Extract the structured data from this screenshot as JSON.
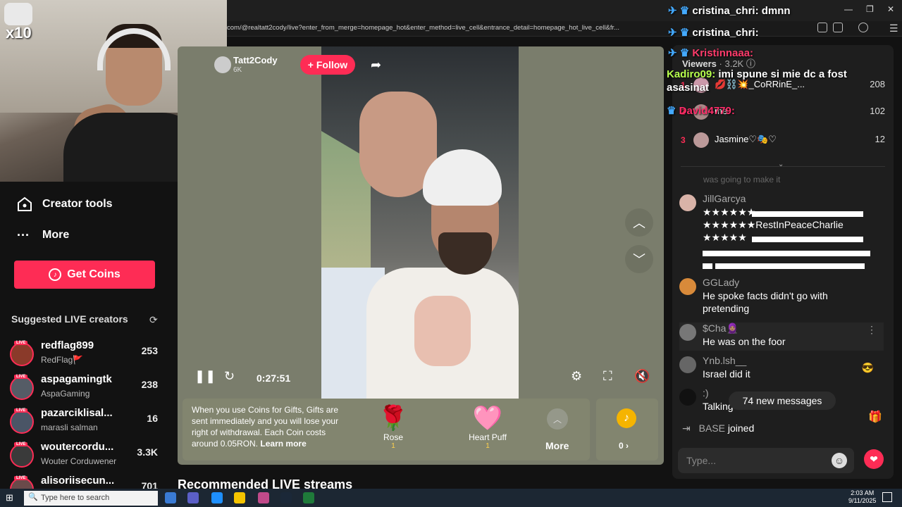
{
  "browser": {
    "url": "com/@realtatt2cody/live?enter_from_merge=homepage_hot&enter_method=live_cell&entrance_detail=homepage_hot_live_cell&fr...",
    "window_controls": [
      "—",
      "❐",
      "✕"
    ]
  },
  "stream_overlay": {
    "multiplier": "x10",
    "chat": [
      {
        "user": "cristina_chri:",
        "text": "dmnn",
        "color": "#ffffff"
      },
      {
        "user": "cristina_chri:",
        "text": "",
        "color": "#ffffff"
      },
      {
        "user": "Kristinnaaa:",
        "text": "",
        "color": "#ff3b6b"
      },
      {
        "user": "Kadiro09:",
        "text": "imi spune si mie dc a fost asasinat",
        "color": "#b7ff4d"
      },
      {
        "user": "David4779:",
        "text": "",
        "color": "#ff2d6a"
      }
    ]
  },
  "sidebar": {
    "items": [
      {
        "label": "Creator tools",
        "icon": "creator-tools-icon"
      },
      {
        "label": "More",
        "icon": "more-dots-icon"
      }
    ],
    "get_coins": "Get Coins",
    "suggested_title": "Suggested LIVE creators",
    "live_badge": "LIVE",
    "creators": [
      {
        "name": "redflag899",
        "sub": "RedFlag🚩",
        "count": "253",
        "color": "#8a3a2a"
      },
      {
        "name": "aspagamingtk",
        "sub": "AspaGaming",
        "count": "238",
        "color": "#555c66"
      },
      {
        "name": "pazarciklisal...",
        "sub": "marasli salman",
        "count": "16",
        "color": "#4a5566"
      },
      {
        "name": "woutercordu...",
        "sub": "Wouter Corduwener",
        "count": "3.3K",
        "color": "#3a3a3a"
      },
      {
        "name": "alisoriisecun...",
        "sub": "",
        "count": "701",
        "color": "#6a4a4a"
      }
    ]
  },
  "video": {
    "host_name": "Tatt2Cody",
    "host_followers": "6K",
    "follow": "+ Follow",
    "time": "0:27:51",
    "gift_note_prefix": "When you use Coins for Gifts, Gifts are sent immediately and you will lose your right of withdrawal. Each Coin costs around 0.05RON.",
    "learn_more": "Learn more",
    "gifts": [
      {
        "name": "Rose",
        "cost": "1",
        "icon": "🌹"
      },
      {
        "name": "Heart Puff",
        "cost": "1",
        "icon": "🩷"
      }
    ],
    "more": "More",
    "coin_balance": "0 ›",
    "recommended": "Recommended LIVE streams"
  },
  "right_panel": {
    "viewers_label": "Viewers",
    "viewers_count": "· 3.2K",
    "top_viewers": [
      {
        "rank": "1",
        "name": "💋⛓️💥_CoRRinE_...",
        "count": "208"
      },
      {
        "rank": "2",
        "name": "me.",
        "count": "102"
      },
      {
        "rank": "3",
        "name": "Jasmine♡🎭♡",
        "count": "12"
      }
    ],
    "faded_text": "was going to make it",
    "comments": [
      {
        "user": "JillGarcya",
        "text": "★★★★★★",
        "color": "#d9b3a8"
      },
      {
        "user": "GGLady",
        "text": "He spoke facts didn't go with pretending",
        "color": "#d88a3a"
      },
      {
        "user": "$Cha🧕🏽",
        "text": "He was on the foor",
        "color": "#777"
      },
      {
        "user": "Ynb.lsh__",
        "text": "Israel did it",
        "color": "#666"
      },
      {
        "user": ":)",
        "text": "Talking",
        "color": "#111"
      }
    ],
    "jill_line2": "★★★★★★RestInPeaceCharlie",
    "jill_line3": "★★★★★",
    "new_messages": "74 new messages",
    "joined_user": "BASE",
    "joined_text": "joined",
    "input_placeholder": "Type..."
  },
  "taskbar": {
    "search_placeholder": "Type here to search",
    "time": "2:03 AM",
    "date": "9/11/2025"
  },
  "colors": {
    "accent": "#fe2c55",
    "coin": "#f5b400",
    "panel": "#1e1e1e"
  }
}
